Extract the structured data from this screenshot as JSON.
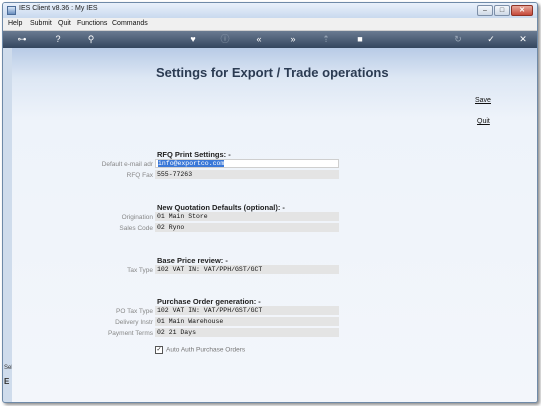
{
  "window": {
    "title": "IES Client v8.36 : My IES",
    "buttons": {
      "minimize": "–",
      "maximize": "□",
      "close": "✕"
    }
  },
  "menubar": {
    "items": [
      "Help",
      "Submit",
      "Quit",
      "Functions",
      "Commands"
    ]
  },
  "toolbar": {
    "icons": [
      "key-icon",
      "help-icon",
      "search-icon",
      "heart-icon",
      "info-icon",
      "rewind-icon",
      "fast-forward-icon",
      "upload-icon",
      "stop-icon",
      "refresh-icon",
      "check-icon",
      "close-icon"
    ],
    "glyphs": {
      "key": "⊶",
      "help": "?",
      "search": "⚲",
      "heart": "♥",
      "info": "ⓘ",
      "rewind": "«",
      "forward": "»",
      "upload": "⇡",
      "stop": "■",
      "refresh": "↻",
      "check": "✓",
      "close": "✕"
    }
  },
  "page": {
    "title": "Settings for Export / Trade operations",
    "save_label": "Save",
    "quit_label": "Quit"
  },
  "rfq": {
    "heading": "RFQ Print Settings: -",
    "email_label": "Default e-mail adr",
    "email_value": "info@exportco.com",
    "fax_label": "RFQ Fax",
    "fax_value": "555-77263"
  },
  "quotation": {
    "heading": "New Quotation Defaults (optional): -",
    "origination_label": "Origination",
    "origination_value": "01 Main Store",
    "sales_code_label": "Sales Code",
    "sales_code_value": "02 Ryno"
  },
  "base_price": {
    "heading": "Base Price review: -",
    "tax_type_label": "Tax Type",
    "tax_type_value": "102 VAT IN: VAT/PPH/GST/GCT"
  },
  "purchase_order": {
    "heading": "Purchase Order generation: -",
    "po_tax_type_label": "PO Tax Type",
    "po_tax_type_value": "102 VAT IN: VAT/PPH/GST/GCT",
    "delivery_instr_label": "Delivery Instr",
    "delivery_instr_value": "01 Main Warehouse",
    "payment_terms_label": "Payment Terms",
    "payment_terms_value": "02 21 Days",
    "auto_auth_label": "Auto Auth Purchase Orders",
    "auto_auth_checked": true,
    "check_glyph": "✓"
  },
  "sidebar_stub": {
    "top_text": "Sel",
    "bottom_text": "E"
  },
  "colors": {
    "toolbar_bg": "#34465e",
    "selection": "#3a78d8",
    "field_bg": "#e4e4e4"
  }
}
